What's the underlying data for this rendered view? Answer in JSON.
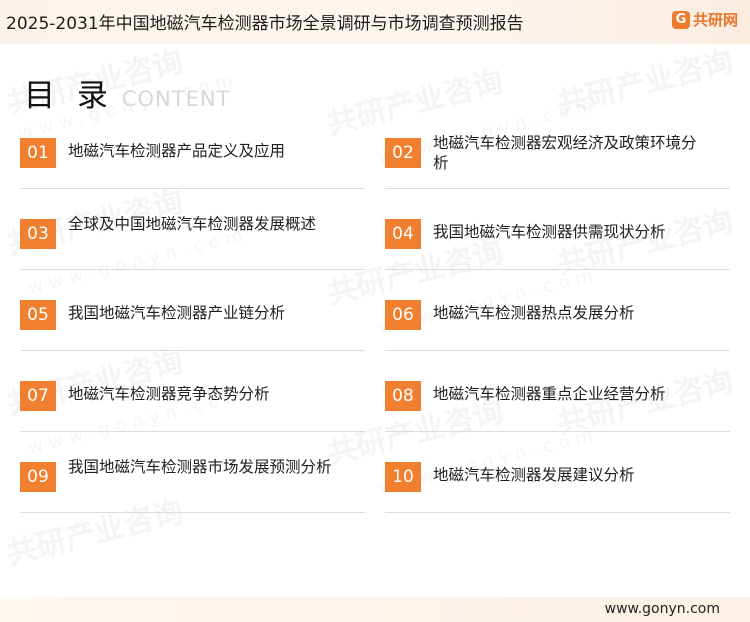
{
  "header": {
    "title": "2025-2031年中国地磁汽车检测器市场全景调研与市场调查预测报告",
    "logo_mark": "G",
    "logo_text": "共研网"
  },
  "toc": {
    "title": "目 录",
    "subtitle": "CONTENT",
    "items": [
      {
        "num": "01",
        "label": "地磁汽车检测器产品定义及应用"
      },
      {
        "num": "02",
        "label": "地磁汽车检测器宏观经济及政策环境分析"
      },
      {
        "num": "03",
        "label": "全球及中国地磁汽车检测器发展概述"
      },
      {
        "num": "04",
        "label": "我国地磁汽车检测器供需现状分析"
      },
      {
        "num": "05",
        "label": "我国地磁汽车检测器产业链分析"
      },
      {
        "num": "06",
        "label": "地磁汽车检测器热点发展分析"
      },
      {
        "num": "07",
        "label": "地磁汽车检测器竞争态势分析"
      },
      {
        "num": "08",
        "label": "地磁汽车检测器重点企业经营分析"
      },
      {
        "num": "09",
        "label": "我国地磁汽车检测器市场发展预测分析"
      },
      {
        "num": "10",
        "label": "地磁汽车检测器发展建议分析"
      }
    ]
  },
  "watermark": {
    "text": "共研产业咨询",
    "url_text": "www.gonyn.com"
  },
  "footer": {
    "url": "www.gonyn.com"
  },
  "colors": {
    "accent": "#f07f2f",
    "header_bg": "#fdf3ea",
    "rule": "#dcdcdc"
  }
}
